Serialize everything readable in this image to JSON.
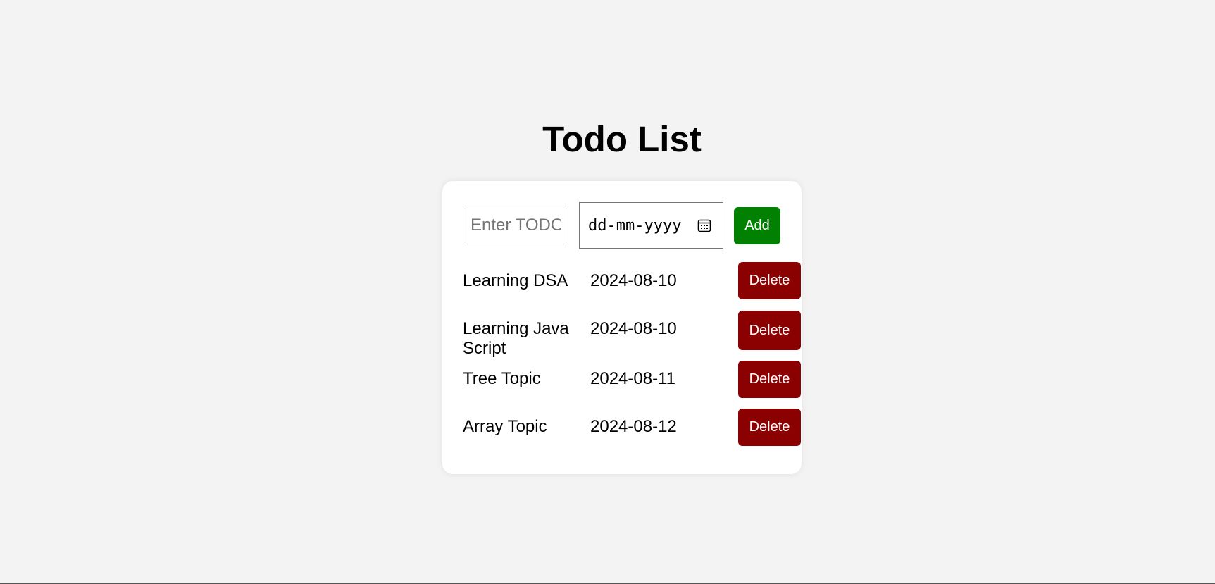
{
  "page": {
    "title": "Todo List"
  },
  "form": {
    "todo_placeholder": "Enter TODO",
    "todo_value": "",
    "date_placeholder": "dd-mm-yyyy",
    "add_label": "Add"
  },
  "todos": [
    {
      "name": "Learning DSA",
      "date": "2024-08-10",
      "delete_label": "Delete"
    },
    {
      "name": "Learning Java Script",
      "date": "2024-08-10",
      "delete_label": "Delete"
    },
    {
      "name": "Tree Topic",
      "date": "2024-08-11",
      "delete_label": "Delete"
    },
    {
      "name": "Array Topic",
      "date": "2024-08-12",
      "delete_label": "Delete"
    }
  ],
  "icons": {
    "date_picker": "calendar-icon"
  },
  "colors": {
    "background": "#f3f3f3",
    "card": "#ffffff",
    "add_button": "#028002",
    "delete_button": "#8b0000"
  }
}
